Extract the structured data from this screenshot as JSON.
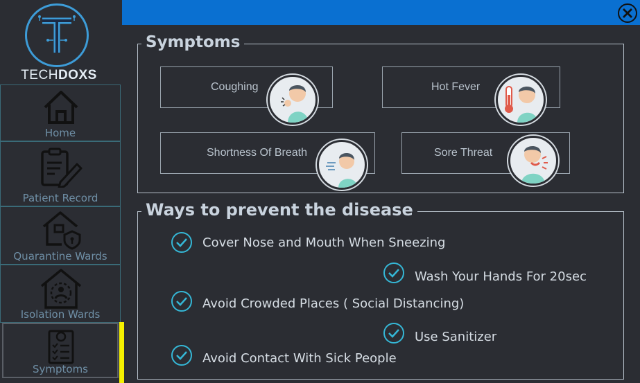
{
  "brand": {
    "name_part1": "TECH",
    "name_part2": "DOXS"
  },
  "sidebar": {
    "items": [
      {
        "label": "Home",
        "icon": "home-icon"
      },
      {
        "label": "Patient Record",
        "icon": "clipboard-icon"
      },
      {
        "label": "Quarantine Wards",
        "icon": "house-shield-icon"
      },
      {
        "label": "Isolation Wards",
        "icon": "house-person-icon"
      },
      {
        "label": "Symptoms",
        "icon": "checklist-icon"
      }
    ],
    "active_index": 4
  },
  "colors": {
    "topbar": "#0a70d1",
    "active_indicator": "#f4f000",
    "check": "#35b7d6",
    "logo_ring": "#3d9cd8"
  },
  "symptoms": {
    "title": "Symptoms",
    "items": [
      {
        "label": "Coughing",
        "icon": "coughing-person-icon"
      },
      {
        "label": "Hot Fever",
        "icon": "fever-thermometer-icon"
      },
      {
        "label": "Shortness Of Breath",
        "icon": "breath-person-icon"
      },
      {
        "label": "Sore Threat",
        "icon": "sore-throat-icon"
      }
    ]
  },
  "prevention": {
    "title": "Ways to prevent the disease",
    "items": [
      {
        "text": "Cover Nose and Mouth When Sneezing"
      },
      {
        "text": "Wash Your Hands For 20sec"
      },
      {
        "text": "Avoid Crowded Places ( Social Distancing)"
      },
      {
        "text": "Use Sanitizer"
      },
      {
        "text": "Avoid Contact With Sick People"
      }
    ]
  }
}
